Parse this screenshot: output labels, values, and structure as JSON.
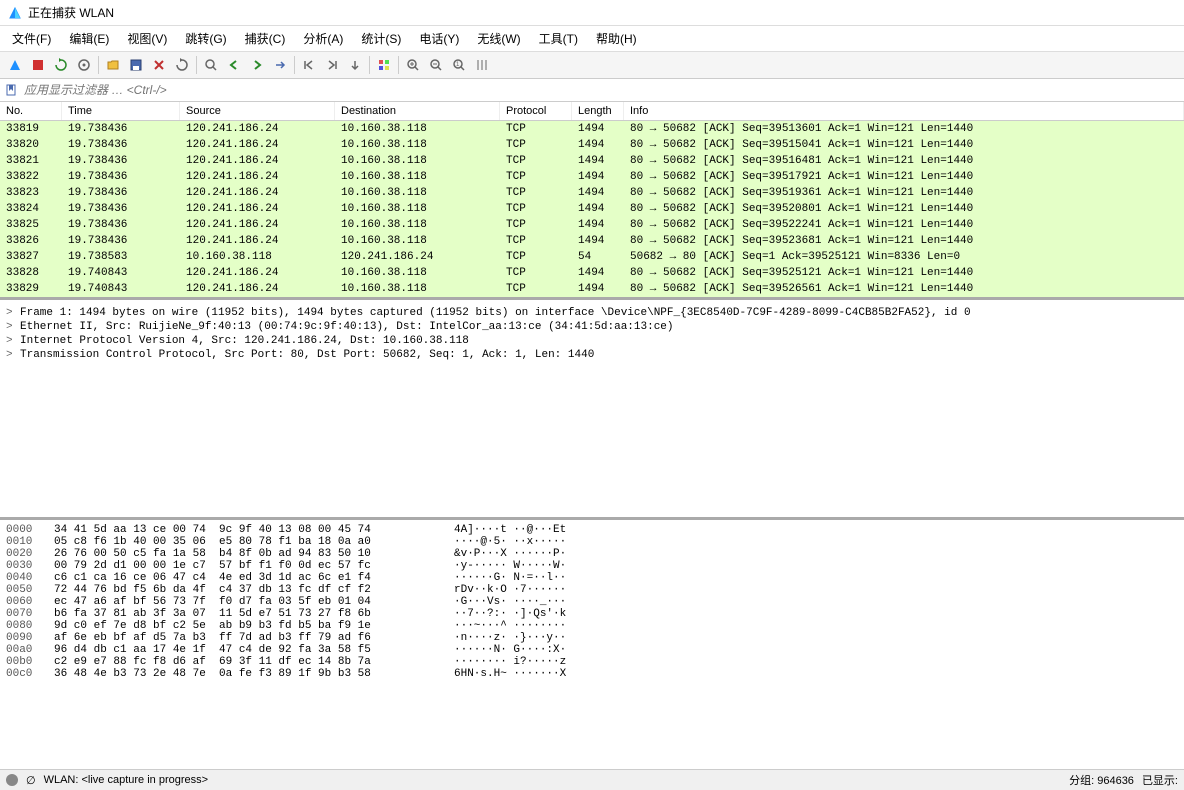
{
  "window": {
    "title": "正在捕获 WLAN"
  },
  "menu": [
    "文件(F)",
    "编辑(E)",
    "视图(V)",
    "跳转(G)",
    "捕获(C)",
    "分析(A)",
    "统计(S)",
    "电话(Y)",
    "无线(W)",
    "工具(T)",
    "帮助(H)"
  ],
  "filter": {
    "placeholder": "应用显示过滤器 … <Ctrl-/>"
  },
  "columns": {
    "no": "No.",
    "time": "Time",
    "src": "Source",
    "dst": "Destination",
    "proto": "Protocol",
    "len": "Length",
    "info": "Info"
  },
  "packets": [
    {
      "no": "33819",
      "time": "19.738436",
      "src": "120.241.186.24",
      "dst": "10.160.38.118",
      "proto": "TCP",
      "len": "1494",
      "info": "80 → 50682 [ACK] Seq=39513601 Ack=1 Win=121 Len=1440"
    },
    {
      "no": "33820",
      "time": "19.738436",
      "src": "120.241.186.24",
      "dst": "10.160.38.118",
      "proto": "TCP",
      "len": "1494",
      "info": "80 → 50682 [ACK] Seq=39515041 Ack=1 Win=121 Len=1440"
    },
    {
      "no": "33821",
      "time": "19.738436",
      "src": "120.241.186.24",
      "dst": "10.160.38.118",
      "proto": "TCP",
      "len": "1494",
      "info": "80 → 50682 [ACK] Seq=39516481 Ack=1 Win=121 Len=1440"
    },
    {
      "no": "33822",
      "time": "19.738436",
      "src": "120.241.186.24",
      "dst": "10.160.38.118",
      "proto": "TCP",
      "len": "1494",
      "info": "80 → 50682 [ACK] Seq=39517921 Ack=1 Win=121 Len=1440"
    },
    {
      "no": "33823",
      "time": "19.738436",
      "src": "120.241.186.24",
      "dst": "10.160.38.118",
      "proto": "TCP",
      "len": "1494",
      "info": "80 → 50682 [ACK] Seq=39519361 Ack=1 Win=121 Len=1440"
    },
    {
      "no": "33824",
      "time": "19.738436",
      "src": "120.241.186.24",
      "dst": "10.160.38.118",
      "proto": "TCP",
      "len": "1494",
      "info": "80 → 50682 [ACK] Seq=39520801 Ack=1 Win=121 Len=1440"
    },
    {
      "no": "33825",
      "time": "19.738436",
      "src": "120.241.186.24",
      "dst": "10.160.38.118",
      "proto": "TCP",
      "len": "1494",
      "info": "80 → 50682 [ACK] Seq=39522241 Ack=1 Win=121 Len=1440"
    },
    {
      "no": "33826",
      "time": "19.738436",
      "src": "120.241.186.24",
      "dst": "10.160.38.118",
      "proto": "TCP",
      "len": "1494",
      "info": "80 → 50682 [ACK] Seq=39523681 Ack=1 Win=121 Len=1440"
    },
    {
      "no": "33827",
      "time": "19.738583",
      "src": "10.160.38.118",
      "dst": "120.241.186.24",
      "proto": "TCP",
      "len": "54",
      "info": "50682 → 80 [ACK] Seq=1 Ack=39525121 Win=8336 Len=0"
    },
    {
      "no": "33828",
      "time": "19.740843",
      "src": "120.241.186.24",
      "dst": "10.160.38.118",
      "proto": "TCP",
      "len": "1494",
      "info": "80 → 50682 [ACK] Seq=39525121 Ack=1 Win=121 Len=1440"
    },
    {
      "no": "33829",
      "time": "19.740843",
      "src": "120.241.186.24",
      "dst": "10.160.38.118",
      "proto": "TCP",
      "len": "1494",
      "info": "80 → 50682 [ACK] Seq=39526561 Ack=1 Win=121 Len=1440"
    }
  ],
  "details": [
    "Frame 1: 1494 bytes on wire (11952 bits), 1494 bytes captured (11952 bits) on interface \\Device\\NPF_{3EC8540D-7C9F-4289-8099-C4CB85B2FA52}, id 0",
    "Ethernet II, Src: RuijieNe_9f:40:13 (00:74:9c:9f:40:13), Dst: IntelCor_aa:13:ce (34:41:5d:aa:13:ce)",
    "Internet Protocol Version 4, Src: 120.241.186.24, Dst: 10.160.38.118",
    "Transmission Control Protocol, Src Port: 80, Dst Port: 50682, Seq: 1, Ack: 1, Len: 1440"
  ],
  "hex": [
    {
      "off": "0000",
      "b": "34 41 5d aa 13 ce 00 74  9c 9f 40 13 08 00 45 74",
      "a": "4A]····t ··@···Et"
    },
    {
      "off": "0010",
      "b": "05 c8 f6 1b 40 00 35 06  e5 80 78 f1 ba 18 0a a0",
      "a": "····@·5· ··x·····"
    },
    {
      "off": "0020",
      "b": "26 76 00 50 c5 fa 1a 58  b4 8f 0b ad 94 83 50 10",
      "a": "&v·P···X ······P·"
    },
    {
      "off": "0030",
      "b": "00 79 2d d1 00 00 1e c7  57 bf f1 f0 0d ec 57 fc",
      "a": "·y-····· W·····W·"
    },
    {
      "off": "0040",
      "b": "c6 c1 ca 16 ce 06 47 c4  4e ed 3d 1d ac 6c e1 f4",
      "a": "······G· N·=··l··"
    },
    {
      "off": "0050",
      "b": "72 44 76 bd f5 6b da 4f  c4 37 db 13 fc df cf f2",
      "a": "rDv··k·O ·7······"
    },
    {
      "off": "0060",
      "b": "ec 47 a6 af bf 56 73 7f  f0 d7 fa 03 5f eb 01 04",
      "a": "·G···Vs· ····_···"
    },
    {
      "off": "0070",
      "b": "b6 fa 37 81 ab 3f 3a 07  11 5d e7 51 73 27 f8 6b",
      "a": "··7··?:· ·]·Qs'·k"
    },
    {
      "off": "0080",
      "b": "9d c0 ef 7e d8 bf c2 5e  ab b9 b3 fd b5 ba f9 1e",
      "a": "···~···^ ········"
    },
    {
      "off": "0090",
      "b": "af 6e eb bf af d5 7a b3  ff 7d ad b3 ff 79 ad f6",
      "a": "·n····z· ·}···y··"
    },
    {
      "off": "00a0",
      "b": "96 d4 db c1 aa 17 4e 1f  47 c4 de 92 fa 3a 58 f5",
      "a": "······N· G····:X·"
    },
    {
      "off": "00b0",
      "b": "c2 e9 e7 88 fc f8 d6 af  69 3f 11 df ec 14 8b 7a",
      "a": "········ i?·····z"
    },
    {
      "off": "00c0",
      "b": "36 48 4e b3 73 2e 48 7e  0a fe f3 89 1f 9b b3 58",
      "a": "6HN·s.H~ ·······X"
    }
  ],
  "status": {
    "left": "WLAN: <live capture in progress>",
    "packets": "分组: 964636",
    "displayed": "已显示:"
  }
}
